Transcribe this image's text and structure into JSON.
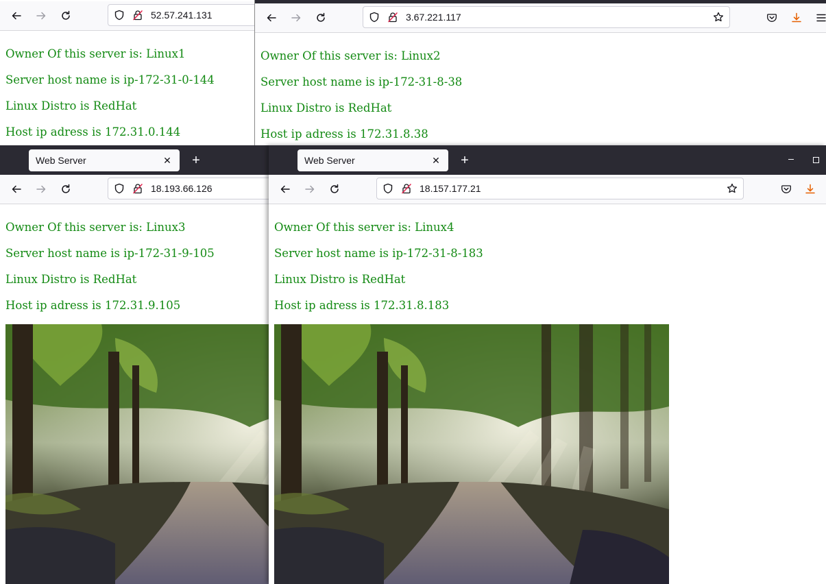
{
  "colors": {
    "text_green": "#138a13",
    "tabstrip": "#2b2a33",
    "download_accent": "#e66000"
  },
  "windows": [
    {
      "url": "52.57.241.131",
      "lines": [
        "Owner Of this server is: Linux1",
        "Server host name is ip-172-31-0-144",
        "Linux Distro is RedHat",
        "Host ip adress is 172.31.0.144"
      ]
    },
    {
      "url": "3.67.221.117",
      "lines": [
        "Owner Of this server is: Linux2",
        "Server host name is ip-172-31-8-38",
        "Linux Distro is RedHat",
        "Host ip adress is 172.31.8.38"
      ]
    },
    {
      "tab_title": "Web Server",
      "url": "18.193.66.126",
      "lines": [
        "Owner Of this server is: Linux3",
        "Server host name is ip-172-31-9-105",
        "Linux Distro is RedHat",
        "Host ip adress is 172.31.9.105"
      ],
      "image": "forest-path-photo"
    },
    {
      "tab_title": "Web Server",
      "url": "18.157.177.21",
      "lines": [
        "Owner Of this server is: Linux4",
        "Server host name is ip-172-31-8-183",
        "Linux Distro is RedHat",
        "Host ip adress is 172.31.8.183"
      ],
      "image": "forest-path-photo"
    }
  ],
  "icons": {
    "back": "arrow-left-icon",
    "forward": "arrow-right-icon",
    "reload": "reload-icon",
    "tracking": "shield-icon",
    "insecure": "lock-slash-icon",
    "bookmark": "star-icon",
    "pocket": "pocket-icon",
    "downloads": "download-icon",
    "menu": "hamburger-icon",
    "minimize": "minimize-icon",
    "maximize": "maximize-icon",
    "new_tab": "plus-icon",
    "tab_close": "close-icon"
  }
}
